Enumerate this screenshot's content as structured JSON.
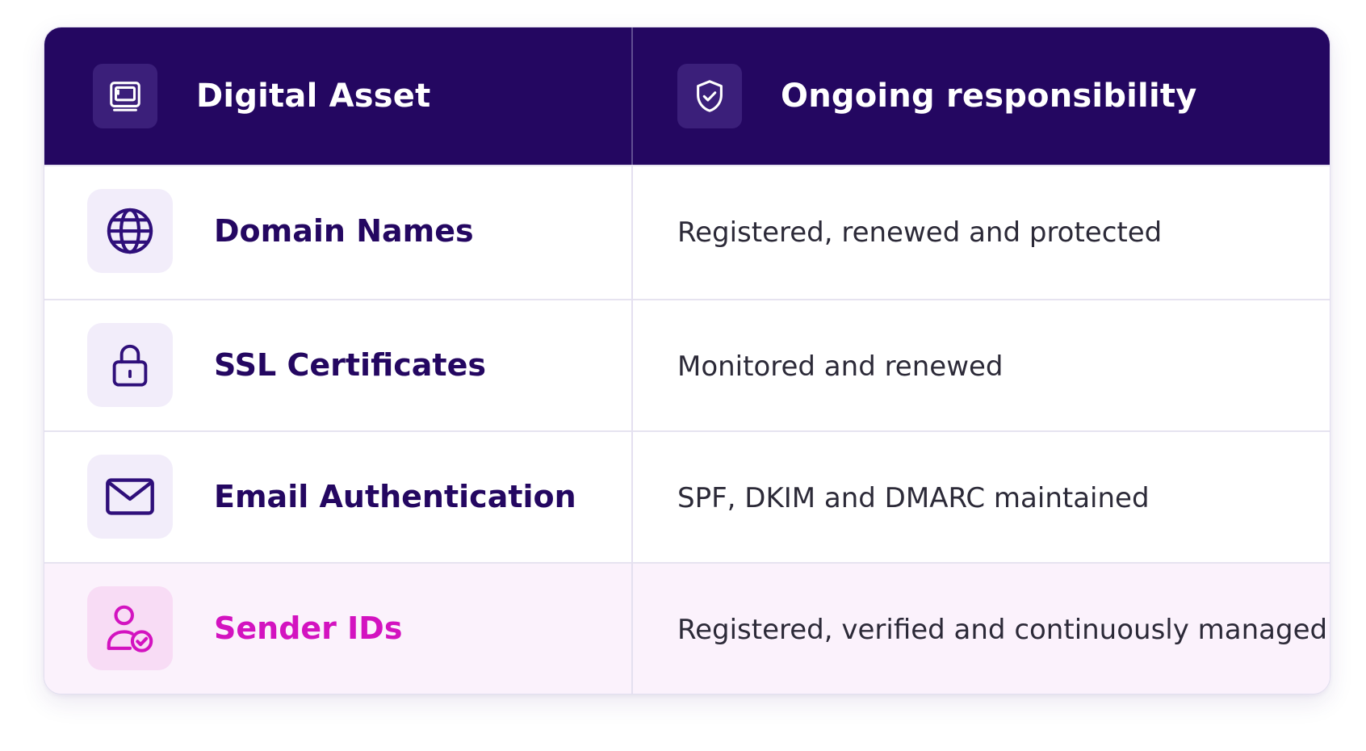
{
  "colors": {
    "header_bg": "#240761",
    "accent": "#d313c0",
    "title_text": "#240761",
    "icon_stroke": "#2f0f7a"
  },
  "header": {
    "asset_label": "Digital Asset",
    "asset_icon": "monitor-icon",
    "responsibility_label": "Ongoing responsibility",
    "responsibility_icon": "shield-check-icon"
  },
  "rows": [
    {
      "icon": "globe-icon",
      "asset": "Domain Names",
      "responsibility": "Registered, renewed and protected"
    },
    {
      "icon": "lock-icon",
      "asset": "SSL Certificates",
      "responsibility": "Monitored and renewed"
    },
    {
      "icon": "envelope-icon",
      "asset": "Email Authentication",
      "responsibility": "SPF, DKIM and DMARC maintained"
    },
    {
      "icon": "user-check-icon",
      "asset": "Sender IDs",
      "responsibility": "Registered, verified and continuously managed",
      "highlighted": true
    }
  ]
}
